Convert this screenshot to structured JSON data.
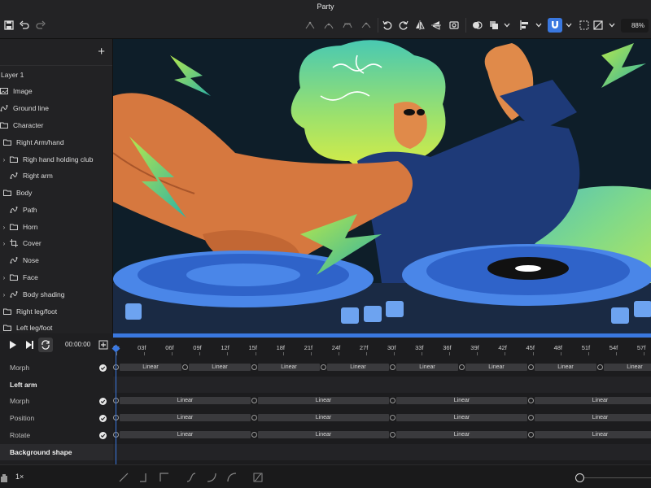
{
  "app": {
    "title": "Party"
  },
  "toolbar": {
    "zoom": "88%",
    "accent": "#3a78e0"
  },
  "layers": {
    "items": [
      {
        "label": "Layer 1",
        "icon": "none",
        "chevron": false
      },
      {
        "label": "Image",
        "icon": "image-icon",
        "chevron": false
      },
      {
        "label": "Ground line",
        "icon": "path-icon",
        "chevron": false
      },
      {
        "label": "Character",
        "icon": "folder-icon",
        "chevron": false
      },
      {
        "label": "Right Arm/hand",
        "icon": "folder-icon",
        "chevron": false
      },
      {
        "label": "Righ hand holding club",
        "icon": "folder-icon",
        "chevron": true
      },
      {
        "label": "Right arm",
        "icon": "path-icon",
        "chevron": false
      },
      {
        "label": "Body",
        "icon": "folder-icon",
        "chevron": false
      },
      {
        "label": "Path",
        "icon": "path-icon",
        "chevron": false
      },
      {
        "label": "Horn",
        "icon": "folder-icon",
        "chevron": true
      },
      {
        "label": "Cover",
        "icon": "crop-icon",
        "chevron": true
      },
      {
        "label": "Nose",
        "icon": "path-icon",
        "chevron": false
      },
      {
        "label": "Face",
        "icon": "folder-icon",
        "chevron": true
      },
      {
        "label": "Body shading",
        "icon": "path-icon",
        "chevron": true
      },
      {
        "label": "Right leg/foot",
        "icon": "folder-icon",
        "chevron": false
      },
      {
        "label": "Left leg/foot",
        "icon": "folder-icon",
        "chevron": false
      }
    ]
  },
  "transport": {
    "time": "00:00:00"
  },
  "timeline": {
    "ticks": [
      "0s",
      "03f",
      "06f",
      "09f",
      "12f",
      "15f",
      "18f",
      "21f",
      "24f",
      "27f",
      "30f",
      "33f",
      "36f",
      "39f",
      "42f",
      "45f",
      "48f",
      "51f",
      "54f",
      "57f"
    ],
    "tracks": [
      {
        "label": "Morph",
        "bold": false,
        "checked": true,
        "segment_label": "Linear",
        "segments": 8
      },
      {
        "label": "Left arm",
        "bold": true,
        "checked": false,
        "segment_label": "",
        "segments": 0
      },
      {
        "label": "Morph",
        "bold": false,
        "checked": true,
        "segment_label": "Linear",
        "segments": 4
      },
      {
        "label": "Position",
        "bold": false,
        "checked": true,
        "segment_label": "Linear",
        "segments": 4
      },
      {
        "label": "Rotate",
        "bold": false,
        "checked": true,
        "segment_label": "Linear",
        "segments": 4
      },
      {
        "label": "Background shape",
        "bold": true,
        "checked": false,
        "segment_label": "",
        "segments": 0
      }
    ]
  },
  "bottom": {
    "speed": "1×"
  }
}
